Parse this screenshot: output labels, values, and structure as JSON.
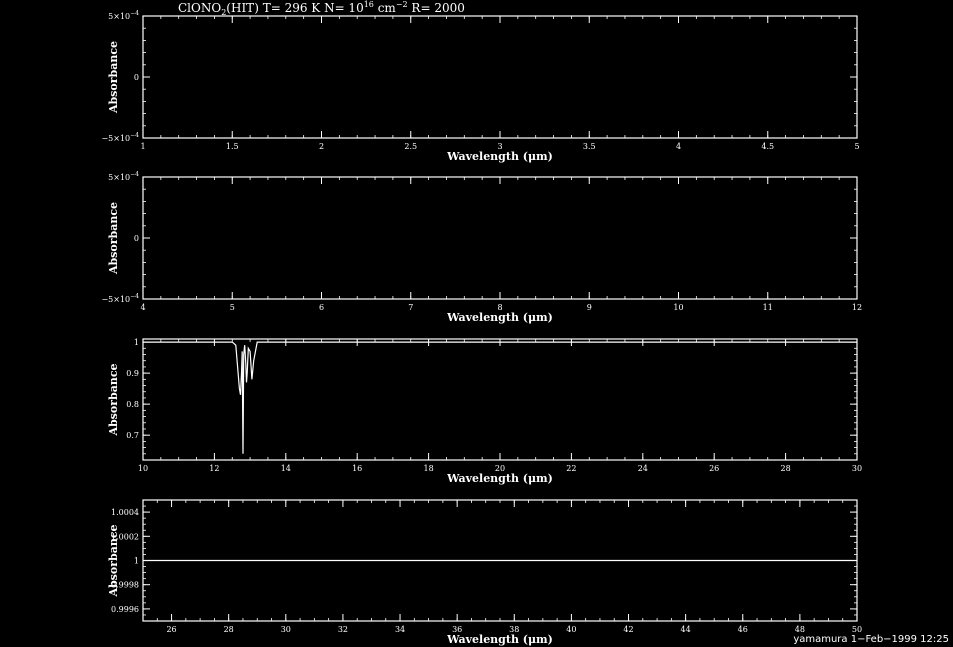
{
  "title": {
    "species": "ClONO",
    "species_sub": "2",
    "source": "(HIT)",
    "temp": " T= 296 K",
    "col_pre": " N= 10",
    "col_exp": "16",
    "col_unit": " cm",
    "col_unit_exp": "−2",
    "res": " R= 2000"
  },
  "footer": "yamamura  1−Feb−1999 12:25",
  "colors": {
    "background": "#000000",
    "foreground": "#ffffff"
  },
  "chart_data": [
    {
      "type": "line",
      "xlabel": "Wavelength (μm)",
      "ylabel": "Absorbance",
      "xlim": [
        1,
        5
      ],
      "ylim": [
        -0.0005,
        0.0005
      ],
      "xticks": [
        1,
        1.5,
        2,
        2.5,
        3,
        3.5,
        4,
        4.5,
        5
      ],
      "xticklabels": [
        "1",
        "1.5",
        "2",
        "2.5",
        "3",
        "3.5",
        "4",
        "4.5",
        "5"
      ],
      "xminor": 0.1,
      "yticks": [
        -0.0005,
        0,
        0.0005
      ],
      "yticklabels": [
        {
          "m": "−5×10",
          "e": "−4"
        },
        {
          "m": "0",
          "e": ""
        },
        {
          "m": "5×10",
          "e": "−4"
        }
      ],
      "yminor": 0.0001,
      "x": [],
      "y": []
    },
    {
      "type": "line",
      "xlabel": "Wavelength (μm)",
      "ylabel": "Absorbance",
      "xlim": [
        4,
        12
      ],
      "ylim": [
        -0.0005,
        0.0005
      ],
      "xticks": [
        4,
        5,
        6,
        7,
        8,
        9,
        10,
        11,
        12
      ],
      "xticklabels": [
        "4",
        "5",
        "6",
        "7",
        "8",
        "9",
        "10",
        "11",
        "12"
      ],
      "xminor": 0.2,
      "yticks": [
        -0.0005,
        0,
        0.0005
      ],
      "yticklabels": [
        {
          "m": "−5×10",
          "e": "−4"
        },
        {
          "m": "0",
          "e": ""
        },
        {
          "m": "5×10",
          "e": "−4"
        }
      ],
      "yminor": 0.0001,
      "x": [],
      "y": []
    },
    {
      "type": "line",
      "xlabel": "Wavelength (μm)",
      "ylabel": "Absorbance",
      "xlim": [
        10,
        30
      ],
      "ylim": [
        0.62,
        1.01
      ],
      "xticks": [
        10,
        12,
        14,
        16,
        18,
        20,
        22,
        24,
        26,
        28,
        30
      ],
      "xticklabels": [
        "10",
        "12",
        "14",
        "16",
        "18",
        "20",
        "22",
        "24",
        "26",
        "28",
        "30"
      ],
      "xminor": 0.5,
      "yticks": [
        0.7,
        0.8,
        0.9,
        1
      ],
      "yticklabels": [
        {
          "m": "0.7",
          "e": ""
        },
        {
          "m": "0.8",
          "e": ""
        },
        {
          "m": "0.9",
          "e": ""
        },
        {
          "m": "1",
          "e": ""
        }
      ],
      "yminor": 0.02,
      "x": [
        10,
        12.5,
        12.6,
        12.65,
        12.7,
        12.73,
        12.76,
        12.78,
        12.8,
        12.82,
        12.85,
        12.88,
        12.9,
        12.92,
        12.95,
        13,
        13.05,
        13.1,
        13.2,
        30
      ],
      "y": [
        1,
        1,
        0.99,
        0.92,
        0.85,
        0.83,
        0.9,
        0.97,
        0.64,
        0.96,
        0.99,
        0.93,
        0.87,
        0.9,
        0.98,
        0.97,
        0.88,
        0.94,
        1,
        1
      ]
    },
    {
      "type": "line",
      "xlabel": "Wavelength (μm)",
      "ylabel": "Absorbance",
      "xlim": [
        25,
        50
      ],
      "ylim": [
        0.9995,
        1.0005
      ],
      "xticks": [
        26,
        28,
        30,
        32,
        34,
        36,
        38,
        40,
        42,
        44,
        46,
        48,
        50
      ],
      "xticklabels": [
        "26",
        "28",
        "30",
        "32",
        "34",
        "36",
        "38",
        "40",
        "42",
        "44",
        "46",
        "48",
        "50"
      ],
      "xminor": 0.5,
      "yticks": [
        0.9996,
        0.9998,
        1,
        1.0002,
        1.0004
      ],
      "yticklabels": [
        {
          "m": "0.9996",
          "e": ""
        },
        {
          "m": "0.9998",
          "e": ""
        },
        {
          "m": "1",
          "e": ""
        },
        {
          "m": "1.0002",
          "e": ""
        },
        {
          "m": "1.0004",
          "e": ""
        }
      ],
      "yminor": 5e-05,
      "x": [
        25,
        50
      ],
      "y": [
        1,
        1
      ]
    }
  ]
}
